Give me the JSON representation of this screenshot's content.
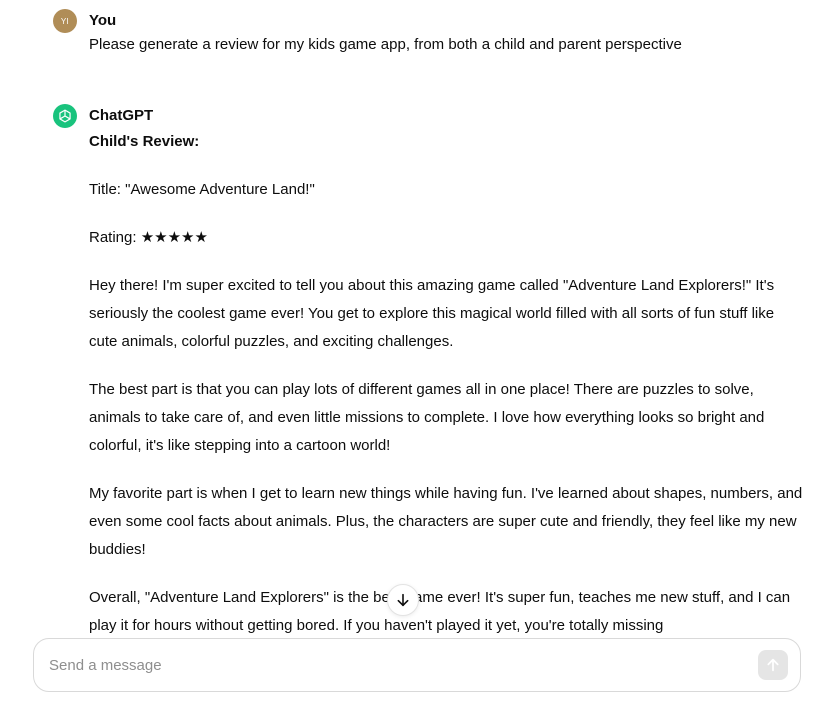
{
  "user_message": {
    "avatar_initials": "YI",
    "author": "You",
    "text": "Please generate a review for my kids game app, from both a child and parent perspective"
  },
  "assistant_message": {
    "author": "ChatGPT",
    "heading": "Child's Review:",
    "title_line": "Title: \"Awesome Adventure Land!\"",
    "rating_label": "Rating: ",
    "rating_stars": "★★★★★",
    "paragraphs": [
      "Hey there! I'm super excited to tell you about this amazing game called \"Adventure Land Explorers!\" It's seriously the coolest game ever! You get to explore this magical world filled with all sorts of fun stuff like cute animals, colorful puzzles, and exciting challenges.",
      "The best part is that you can play lots of different games all in one place! There are puzzles to solve, animals to take care of, and even little missions to complete. I love how everything looks so bright and colorful, it's like stepping into a cartoon world!",
      "My favorite part is when I get to learn new things while having fun. I've learned about shapes, numbers, and even some cool facts about animals. Plus, the characters are super cute and friendly, they feel like my new buddies!"
    ],
    "last_paragraph_start": "Overall, \"Adventure Land Explorers\" is the ",
    "last_paragraph_hidden": "best",
    "last_paragraph_end": " game ever! It's super fun, teaches me new stuff, and I can play it for hours without getting bored. If you haven't played it yet, you're totally missing"
  },
  "composer": {
    "placeholder": "Send a message"
  },
  "icons": {
    "scroll": "arrow-down-icon",
    "send": "arrow-up-icon",
    "assistant": "openai-logo-icon"
  },
  "colors": {
    "user_avatar": "#b08d57",
    "assistant_avatar": "#19c37d",
    "send_disabled": "#e5e5e5"
  }
}
